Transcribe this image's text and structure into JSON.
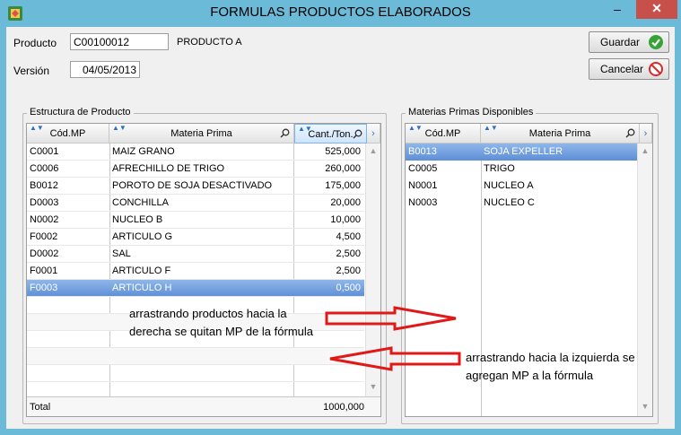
{
  "window": {
    "title": "FORMULAS PRODUCTOS ELABORADOS",
    "minimize": "–",
    "maximize": "□",
    "close": "✕"
  },
  "header": {
    "producto_label": "Producto",
    "producto_code": "C00100012",
    "producto_name": "PRODUCTO A",
    "version_label": "Versión",
    "version_value": "04/05/2013"
  },
  "buttons": {
    "save_label": "Guardar",
    "cancel_label": "Cancelar"
  },
  "structure": {
    "group_title": "Estructura de Producto",
    "columns": [
      "Cód.MP",
      "Materia Prima",
      "Cant./Ton."
    ],
    "rows": [
      {
        "code": "C0001",
        "name": "MAIZ GRANO",
        "qty": "525,000"
      },
      {
        "code": "C0006",
        "name": "AFRECHILLO DE TRIGO",
        "qty": "260,000"
      },
      {
        "code": "B0012",
        "name": "POROTO DE SOJA DESACTIVADO",
        "qty": "175,000"
      },
      {
        "code": "D0003",
        "name": "CONCHILLA",
        "qty": "20,000"
      },
      {
        "code": "N0002",
        "name": "NUCLEO B",
        "qty": "10,000"
      },
      {
        "code": "F0002",
        "name": "ARTICULO G",
        "qty": "4,500"
      },
      {
        "code": "D0002",
        "name": "SAL",
        "qty": "2,500"
      },
      {
        "code": "F0001",
        "name": "ARTICULO F",
        "qty": "2,500"
      },
      {
        "code": "F0003",
        "name": "ARTICULO H",
        "qty": "0,500"
      }
    ],
    "selected_index": 8,
    "total_label": "Total",
    "total_value": "1000,000"
  },
  "available": {
    "group_title": "Materias Primas Disponibles",
    "columns": [
      "Cód.MP",
      "Materia Prima"
    ],
    "rows": [
      {
        "code": "B0013",
        "name": "SOJA EXPELLER"
      },
      {
        "code": "C0005",
        "name": "TRIGO"
      },
      {
        "code": "N0001",
        "name": "NUCLEO A"
      },
      {
        "code": "N0003",
        "name": "NUCLEO C"
      }
    ],
    "selected_index": 0
  },
  "annotations": {
    "right_note_line1": "arrastrando productos hacia la",
    "right_note_line2": "derecha se quitan MP de la fórmula",
    "left_note_line1": "arrastrando hacia la izquierda se",
    "left_note_line2": "agregan MP a la fórmula"
  },
  "colors": {
    "arrow": "#e01818",
    "selection": "#5d8fd6",
    "titlebar": "#6bbad8",
    "close": "#c7504b"
  }
}
